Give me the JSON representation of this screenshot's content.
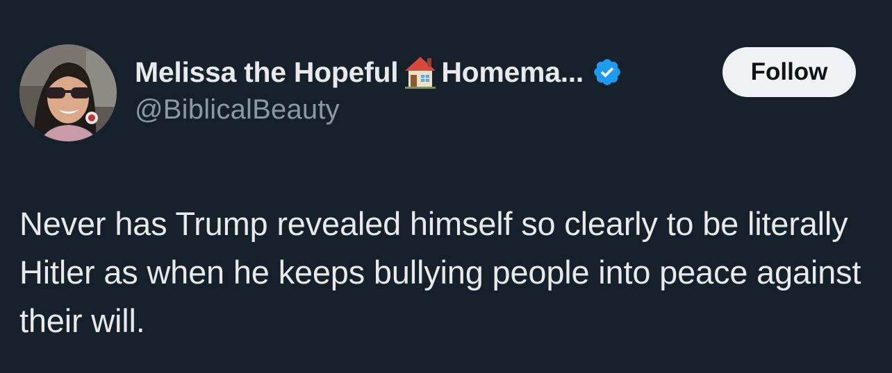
{
  "tweet": {
    "author": {
      "display_name": "Melissa the Hopeful",
      "display_name_suffix": "Homema...",
      "name_emoji": "house-icon",
      "verified_badge": "verified-icon",
      "verified_color": "#1d9bf0",
      "handle": "@BiblicalBeauty",
      "avatar": "avatar"
    },
    "follow_label": "Follow",
    "text": "Never has Trump revealed himself so clearly to be literally Hitler as when he keeps bullying people into peace against their will."
  },
  "colors": {
    "background": "#15202b",
    "primary_text": "#e7e9ea",
    "secondary_text": "#8b98a5",
    "follow_bg": "#eff3f4",
    "follow_text": "#0f1419"
  }
}
